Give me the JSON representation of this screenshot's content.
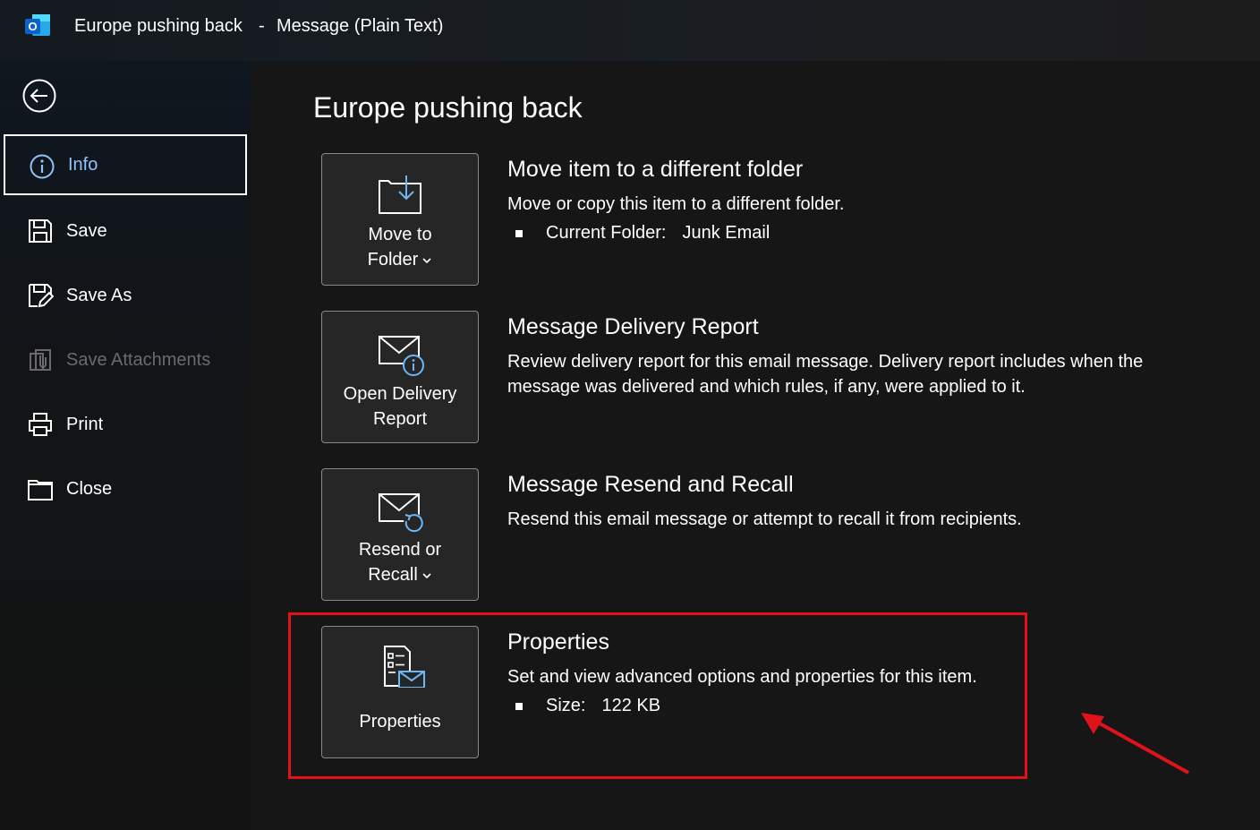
{
  "window": {
    "title_subject": "Europe pushing back",
    "title_separator": "-",
    "title_mode": "Message (Plain Text)"
  },
  "sidebar": {
    "items": [
      {
        "label": "Info",
        "icon": "info-icon",
        "state": "active"
      },
      {
        "label": "Save",
        "icon": "save-icon",
        "state": "normal"
      },
      {
        "label": "Save As",
        "icon": "save-as-icon",
        "state": "normal"
      },
      {
        "label": "Save Attachments",
        "icon": "save-attachments-icon",
        "state": "disabled"
      },
      {
        "label": "Print",
        "icon": "printer-icon",
        "state": "normal"
      },
      {
        "label": "Close",
        "icon": "folder-close-icon",
        "state": "normal"
      }
    ]
  },
  "main": {
    "page_title": "Europe pushing back",
    "sections": [
      {
        "tile_label_line1": "Move to",
        "tile_label_line2": "Folder",
        "tile_icon": "move-to-folder-icon",
        "title": "Move item to a different folder",
        "description": "Move or copy this item to a different folder.",
        "detail_key": "Current Folder:",
        "detail_value": "Junk Email"
      },
      {
        "tile_label_line1": "Open Delivery",
        "tile_label_line2": "Report",
        "tile_icon": "delivery-report-icon",
        "title": "Message Delivery Report",
        "description": "Review delivery report for this email message. Delivery report includes when the message was delivered and which rules, if any, were applied to it."
      },
      {
        "tile_label_line1": "Resend or",
        "tile_label_line2": "Recall",
        "tile_icon": "resend-recall-icon",
        "title": "Message Resend and Recall",
        "description": "Resend this email message or attempt to recall it from recipients."
      },
      {
        "tile_label_line1": "Properties",
        "tile_icon": "properties-icon",
        "title": "Properties",
        "description": "Set and view advanced options and properties for this item.",
        "detail_key": "Size:",
        "detail_value": "122 KB"
      }
    ]
  },
  "colors": {
    "background": "#161616",
    "sidebar": "#121416",
    "tile": "#262626",
    "accent_active": "#8fc3ff",
    "disabled_text": "#6a6a6a",
    "annotation_red": "#e0131a"
  }
}
